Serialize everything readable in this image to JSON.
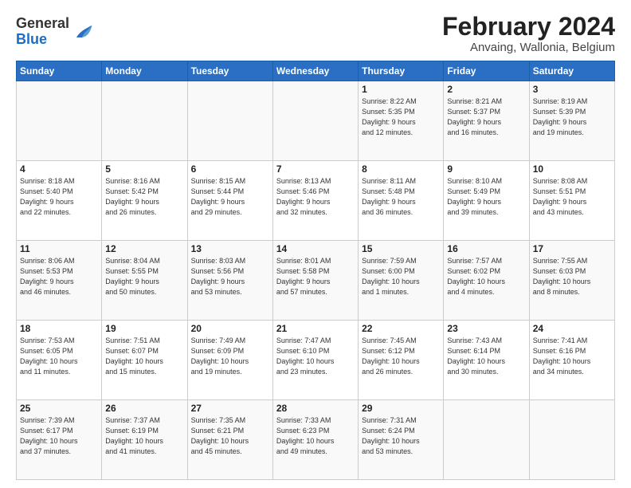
{
  "header": {
    "logo": {
      "general": "General",
      "blue": "Blue"
    },
    "title": "February 2024",
    "subtitle": "Anvaing, Wallonia, Belgium"
  },
  "weekdays": [
    "Sunday",
    "Monday",
    "Tuesday",
    "Wednesday",
    "Thursday",
    "Friday",
    "Saturday"
  ],
  "weeks": [
    [
      null,
      null,
      null,
      null,
      {
        "day": 1,
        "sunrise": "8:22 AM",
        "sunset": "5:35 PM",
        "daylight_hours": 9,
        "daylight_minutes": 12
      },
      {
        "day": 2,
        "sunrise": "8:21 AM",
        "sunset": "5:37 PM",
        "daylight_hours": 9,
        "daylight_minutes": 16
      },
      {
        "day": 3,
        "sunrise": "8:19 AM",
        "sunset": "5:39 PM",
        "daylight_hours": 9,
        "daylight_minutes": 19
      }
    ],
    [
      {
        "day": 4,
        "sunrise": "8:18 AM",
        "sunset": "5:40 PM",
        "daylight_hours": 9,
        "daylight_minutes": 22
      },
      {
        "day": 5,
        "sunrise": "8:16 AM",
        "sunset": "5:42 PM",
        "daylight_hours": 9,
        "daylight_minutes": 26
      },
      {
        "day": 6,
        "sunrise": "8:15 AM",
        "sunset": "5:44 PM",
        "daylight_hours": 9,
        "daylight_minutes": 29
      },
      {
        "day": 7,
        "sunrise": "8:13 AM",
        "sunset": "5:46 PM",
        "daylight_hours": 9,
        "daylight_minutes": 32
      },
      {
        "day": 8,
        "sunrise": "8:11 AM",
        "sunset": "5:48 PM",
        "daylight_hours": 9,
        "daylight_minutes": 36
      },
      {
        "day": 9,
        "sunrise": "8:10 AM",
        "sunset": "5:49 PM",
        "daylight_hours": 9,
        "daylight_minutes": 39
      },
      {
        "day": 10,
        "sunrise": "8:08 AM",
        "sunset": "5:51 PM",
        "daylight_hours": 9,
        "daylight_minutes": 43
      }
    ],
    [
      {
        "day": 11,
        "sunrise": "8:06 AM",
        "sunset": "5:53 PM",
        "daylight_hours": 9,
        "daylight_minutes": 46
      },
      {
        "day": 12,
        "sunrise": "8:04 AM",
        "sunset": "5:55 PM",
        "daylight_hours": 9,
        "daylight_minutes": 50
      },
      {
        "day": 13,
        "sunrise": "8:03 AM",
        "sunset": "5:56 PM",
        "daylight_hours": 9,
        "daylight_minutes": 53
      },
      {
        "day": 14,
        "sunrise": "8:01 AM",
        "sunset": "5:58 PM",
        "daylight_hours": 9,
        "daylight_minutes": 57
      },
      {
        "day": 15,
        "sunrise": "7:59 AM",
        "sunset": "6:00 PM",
        "daylight_hours": 10,
        "daylight_minutes": 1
      },
      {
        "day": 16,
        "sunrise": "7:57 AM",
        "sunset": "6:02 PM",
        "daylight_hours": 10,
        "daylight_minutes": 4
      },
      {
        "day": 17,
        "sunrise": "7:55 AM",
        "sunset": "6:03 PM",
        "daylight_hours": 10,
        "daylight_minutes": 8
      }
    ],
    [
      {
        "day": 18,
        "sunrise": "7:53 AM",
        "sunset": "6:05 PM",
        "daylight_hours": 10,
        "daylight_minutes": 11
      },
      {
        "day": 19,
        "sunrise": "7:51 AM",
        "sunset": "6:07 PM",
        "daylight_hours": 10,
        "daylight_minutes": 15
      },
      {
        "day": 20,
        "sunrise": "7:49 AM",
        "sunset": "6:09 PM",
        "daylight_hours": 10,
        "daylight_minutes": 19
      },
      {
        "day": 21,
        "sunrise": "7:47 AM",
        "sunset": "6:10 PM",
        "daylight_hours": 10,
        "daylight_minutes": 23
      },
      {
        "day": 22,
        "sunrise": "7:45 AM",
        "sunset": "6:12 PM",
        "daylight_hours": 10,
        "daylight_minutes": 26
      },
      {
        "day": 23,
        "sunrise": "7:43 AM",
        "sunset": "6:14 PM",
        "daylight_hours": 10,
        "daylight_minutes": 30
      },
      {
        "day": 24,
        "sunrise": "7:41 AM",
        "sunset": "6:16 PM",
        "daylight_hours": 10,
        "daylight_minutes": 34
      }
    ],
    [
      {
        "day": 25,
        "sunrise": "7:39 AM",
        "sunset": "6:17 PM",
        "daylight_hours": 10,
        "daylight_minutes": 37
      },
      {
        "day": 26,
        "sunrise": "7:37 AM",
        "sunset": "6:19 PM",
        "daylight_hours": 10,
        "daylight_minutes": 41
      },
      {
        "day": 27,
        "sunrise": "7:35 AM",
        "sunset": "6:21 PM",
        "daylight_hours": 10,
        "daylight_minutes": 45
      },
      {
        "day": 28,
        "sunrise": "7:33 AM",
        "sunset": "6:23 PM",
        "daylight_hours": 10,
        "daylight_minutes": 49
      },
      {
        "day": 29,
        "sunrise": "7:31 AM",
        "sunset": "6:24 PM",
        "daylight_hours": 10,
        "daylight_minutes": 53
      },
      null,
      null
    ]
  ]
}
